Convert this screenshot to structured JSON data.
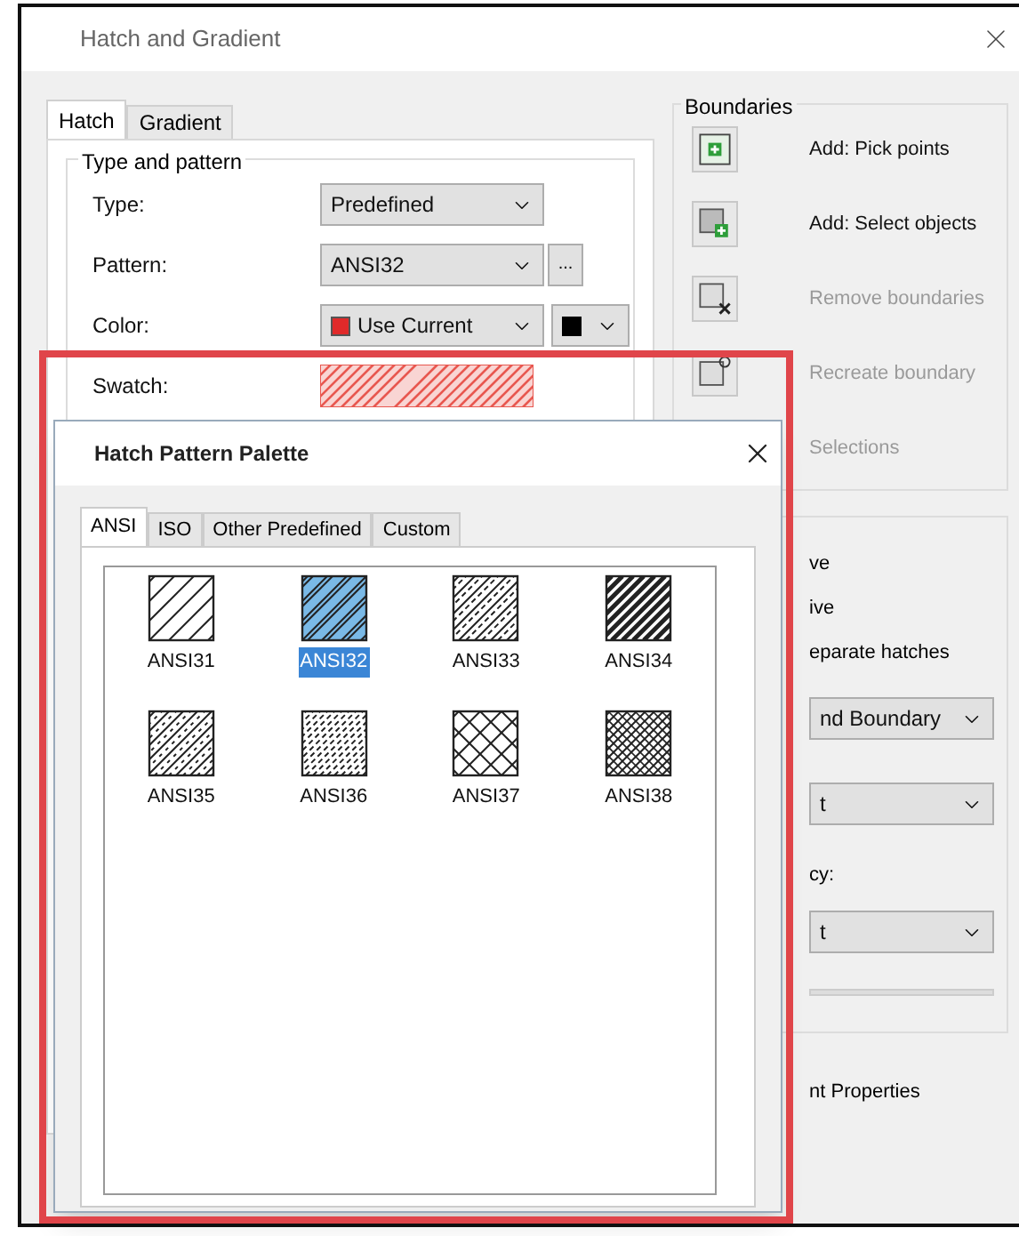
{
  "window": {
    "title": "Hatch and Gradient"
  },
  "tabs": [
    {
      "label": "Hatch",
      "selected": true
    },
    {
      "label": "Gradient",
      "selected": false
    }
  ],
  "type_and_pattern": {
    "title": "Type and pattern",
    "fields": [
      {
        "label": "Type:",
        "kind": "dropdown",
        "value": "Predefined"
      },
      {
        "label": "Pattern:",
        "kind": "browse",
        "value": "ANSI32",
        "button": "..."
      },
      {
        "label": "Color:",
        "kind": "color",
        "value": "Use Current",
        "color": "#e02a2a"
      },
      {
        "label": "Swatch:",
        "kind": "swatch",
        "color": "#e8574f"
      }
    ]
  },
  "boundaries": {
    "title": "Boundaries",
    "buttons": [
      {
        "label": "Add: Pick points",
        "kind": "pick",
        "disabled": false
      },
      {
        "label": "Add: Select objects",
        "kind": "select",
        "disabled": false
      },
      {
        "label": "Remove boundaries",
        "kind": "remove",
        "disabled": true
      },
      {
        "label": "Recreate boundary",
        "kind": "recreate",
        "disabled": true
      },
      {
        "label": "Selections",
        "kind": "view",
        "disabled": true
      }
    ]
  },
  "options": {
    "items": [
      {
        "kind": "text",
        "text": "ve"
      },
      {
        "kind": "text",
        "text": "ive"
      },
      {
        "kind": "text",
        "text": "eparate hatches"
      },
      {
        "kind": "dropdown",
        "value": "nd Boundary"
      },
      {
        "kind": "dropdown",
        "value": "t"
      },
      {
        "kind": "label",
        "text": "cy:"
      },
      {
        "kind": "dropdown",
        "value": "t"
      },
      {
        "kind": "slider"
      }
    ],
    "footer": "nt Properties"
  },
  "palette": {
    "title": "Hatch Pattern Palette",
    "tabs": [
      {
        "label": "ANSI",
        "selected": true
      },
      {
        "label": "ISO",
        "selected": false
      },
      {
        "label": "Other Predefined",
        "selected": false
      },
      {
        "label": "Custom",
        "selected": false
      }
    ],
    "patterns": [
      {
        "name": "ANSI31",
        "kind": "single",
        "selected": false
      },
      {
        "name": "ANSI32",
        "kind": "double",
        "selected": true
      },
      {
        "name": "ANSI33",
        "kind": "dashed",
        "selected": false
      },
      {
        "name": "ANSI34",
        "kind": "band",
        "selected": false
      },
      {
        "name": "ANSI35",
        "kind": "mixed",
        "selected": false
      },
      {
        "name": "ANSI36",
        "kind": "dotted",
        "selected": false
      },
      {
        "name": "ANSI37",
        "kind": "cross",
        "selected": false
      },
      {
        "name": "ANSI38",
        "kind": "dense",
        "selected": false
      }
    ]
  }
}
